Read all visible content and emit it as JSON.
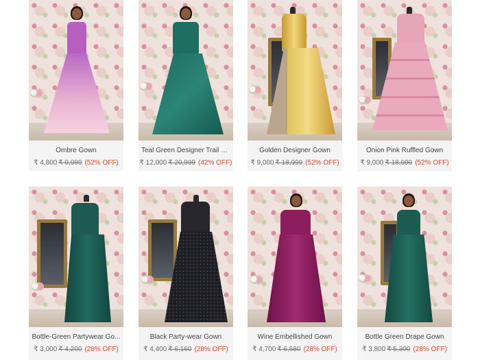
{
  "products": [
    {
      "name": "Ombre Gown",
      "price": "₹ 4,800",
      "mrp": "₹ 9,999",
      "discount": "(52% OFF)"
    },
    {
      "name": "Teal Green Designer Trail G...",
      "price": "₹ 12,000",
      "mrp": "₹ 20,999",
      "discount": "(42% OFF)"
    },
    {
      "name": "Golden Designer Gown",
      "price": "₹ 9,000",
      "mrp": "₹ 18,999",
      "discount": "(52% OFF)"
    },
    {
      "name": "Onion Pink Ruffled Gown",
      "price": "₹ 9,000",
      "mrp": "₹ 18,999",
      "discount": "(52% OFF)"
    },
    {
      "name": "Bottle-Green Partywear Go...",
      "price": "₹ 3,000",
      "mrp": "₹ 4,200",
      "discount": "(28% OFF)"
    },
    {
      "name": "Black Party-wear Gown",
      "price": "₹ 4,400",
      "mrp": "₹ 6,160",
      "discount": "(28% OFF)"
    },
    {
      "name": "Wine Embellished Gown",
      "price": "₹ 4,700",
      "mrp": "₹ 6,580",
      "discount": "(28% OFF)"
    },
    {
      "name": "Bottle Green Drape Gown",
      "price": "₹ 3,800",
      "mrp": "₹ 5,300",
      "discount": "(28% OFF)"
    }
  ],
  "colors": {
    "discount": "#e0492c",
    "card_bg": "#f4f4f4",
    "gown_colors": [
      "#c77ad0",
      "#1f6e62",
      "#d8b24a",
      "#e7a6b8",
      "#1d5a52",
      "#222226",
      "#8b1d5c",
      "#1c5c50"
    ]
  }
}
